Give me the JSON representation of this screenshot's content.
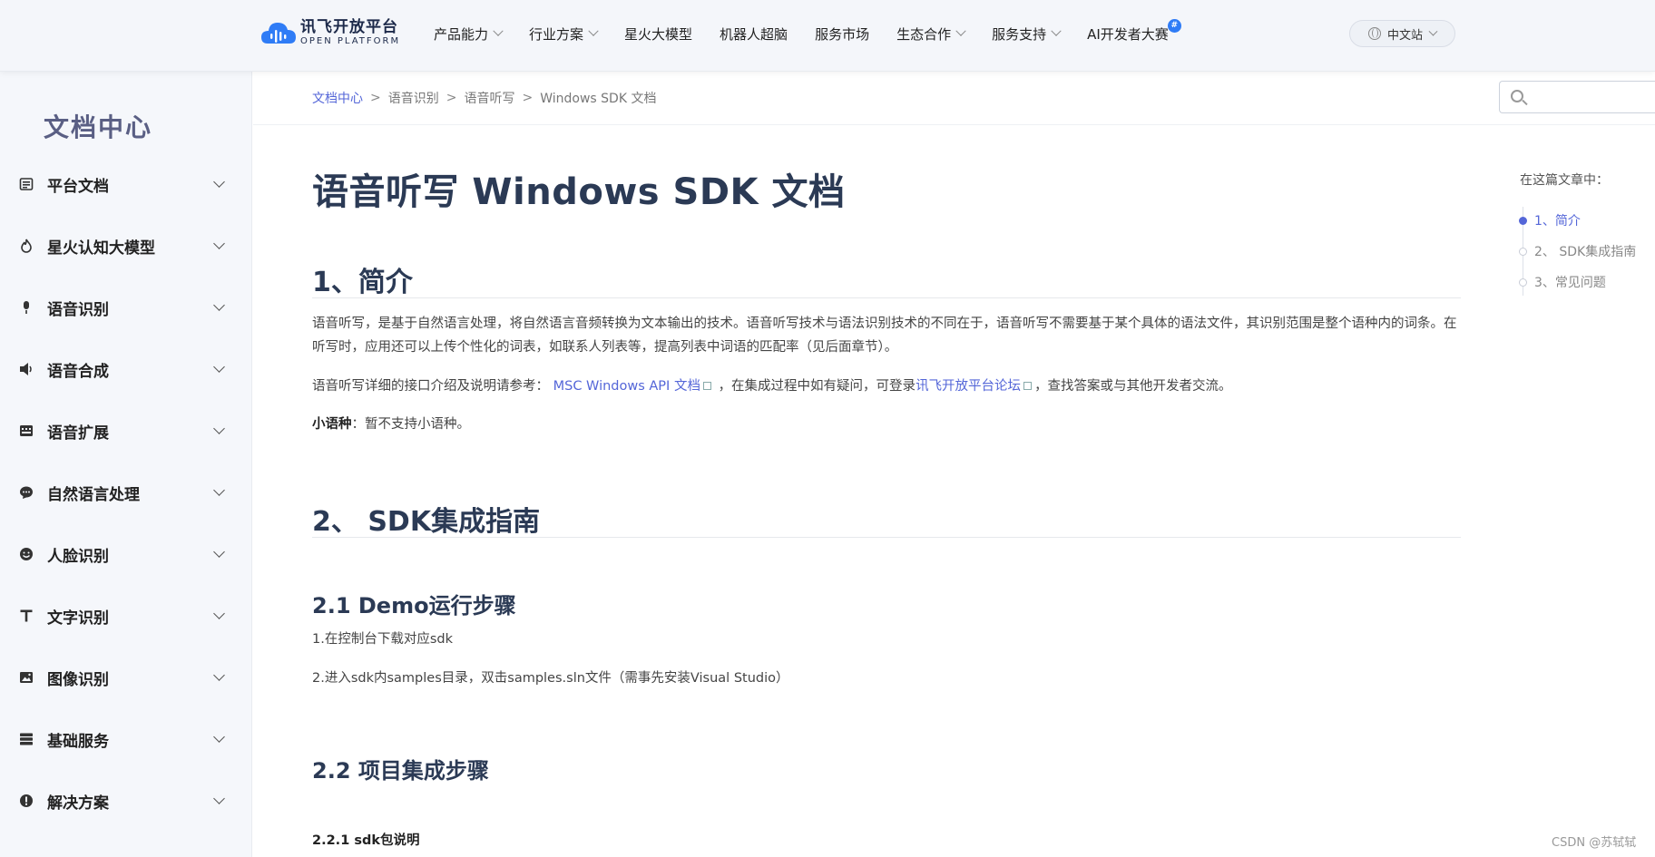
{
  "header": {
    "logo_cn": "讯飞开放平台",
    "logo_en": "OPEN PLATFORM",
    "nav": [
      {
        "label": "产品能力",
        "dropdown": true
      },
      {
        "label": "行业方案",
        "dropdown": true
      },
      {
        "label": "星火大模型",
        "dropdown": false
      },
      {
        "label": "机器人超脑",
        "dropdown": false
      },
      {
        "label": "服务市场",
        "dropdown": false
      },
      {
        "label": "生态合作",
        "dropdown": true
      },
      {
        "label": "服务支持",
        "dropdown": true
      },
      {
        "label": "AI开发者大赛",
        "dropdown": false,
        "badge": "#"
      }
    ],
    "lang": "中文站"
  },
  "sidebar": {
    "title": "文档中心",
    "items": [
      {
        "label": "平台文档",
        "icon": "document-icon"
      },
      {
        "label": "星火认知大模型",
        "icon": "spark-icon"
      },
      {
        "label": "语音识别",
        "icon": "microphone-icon"
      },
      {
        "label": "语音合成",
        "icon": "speaker-icon"
      },
      {
        "label": "语音扩展",
        "icon": "keyboard-icon"
      },
      {
        "label": "自然语言处理",
        "icon": "chat-bubble-icon"
      },
      {
        "label": "人脸识别",
        "icon": "face-icon"
      },
      {
        "label": "文字识别",
        "icon": "text-icon"
      },
      {
        "label": "图像识别",
        "icon": "image-icon"
      },
      {
        "label": "基础服务",
        "icon": "server-icon"
      },
      {
        "label": "解决方案",
        "icon": "alert-icon"
      }
    ]
  },
  "breadcrumb": {
    "items": [
      "文档中心",
      "语音识别",
      "语音听写",
      "Windows SDK 文档"
    ],
    "separator": ">"
  },
  "search": {
    "placeholder": ""
  },
  "article": {
    "title": "语音听写 Windows SDK 文档",
    "s1_heading": "1、简介",
    "s1_p1": "语音听写，是基于自然语言处理，将自然语言音频转换为文本输出的技术。语音听写技术与语法识别技术的不同在于，语音听写不需要基于某个具体的语法文件，其识别范围是整个语种内的词条。在听写时，应用还可以上传个性化的词表，如联系人列表等，提高列表中词语的匹配率（见后面章节）。",
    "s1_p2_prefix": "语音听写详细的接口介绍及说明请参考：",
    "s1_p2_link1": "MSC Windows API 文档",
    "s1_p2_mid": "，在集成过程中如有疑问，可登录",
    "s1_p2_link2": "讯飞开放平台论坛",
    "s1_p2_suffix": "，查找答案或与其他开发者交流。",
    "s1_p3_label": "小语种",
    "s1_p3_text": "：暂不支持小语种。",
    "s2_heading": "2、 SDK集成指南",
    "s21_heading": "2.1 Demo运行步骤",
    "s21_step1": "1.在控制台下载对应sdk",
    "s21_step2": "2.进入sdk内samples目录，双击samples.sln文件（需事先安装Visual Studio）",
    "s22_heading": "2.2 项目集成步骤",
    "s221_heading": "2.2.1 sdk包说明"
  },
  "toc": {
    "title": "在这篇文章中：",
    "items": [
      "1、简介",
      "2、 SDK集成指南",
      "3、常见问题"
    ],
    "active_index": 0
  },
  "watermark": "CSDN @苏轼轼",
  "colors": {
    "accent": "#5466d8",
    "heading": "#2b3a55",
    "brand": "#2f7cf6"
  }
}
